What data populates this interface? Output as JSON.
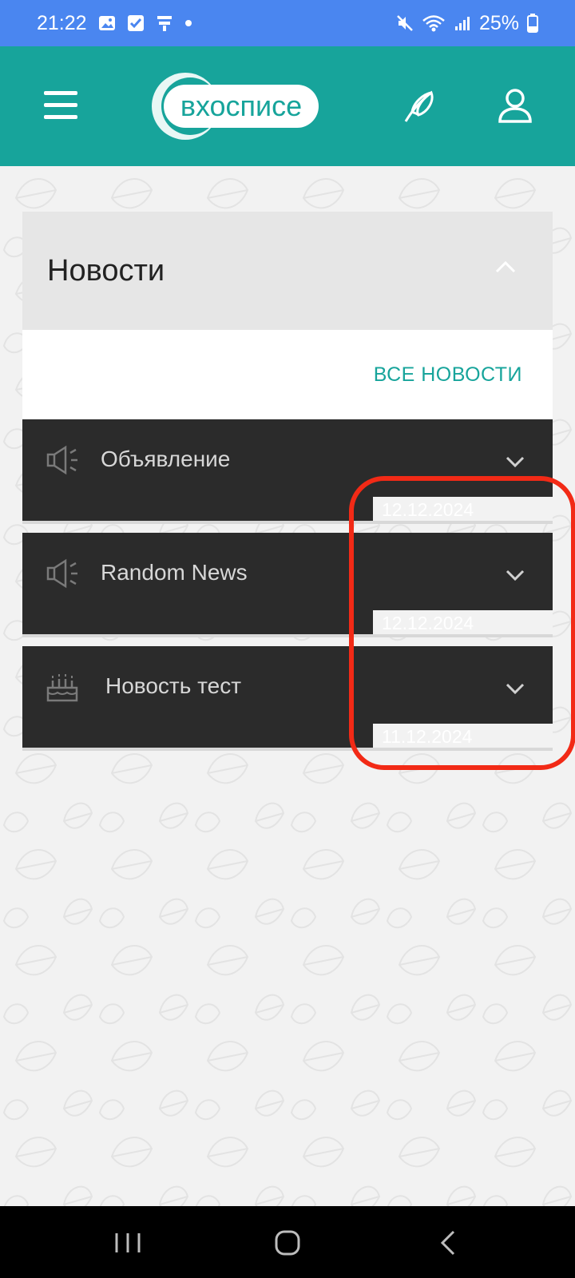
{
  "status_bar": {
    "time": "21:22",
    "battery": "25%",
    "icons_left": [
      "gallery-icon",
      "check-icon",
      "signal-app-icon",
      "dot-icon"
    ],
    "icons_right": [
      "mute-icon",
      "wifi-icon",
      "cell-signal-icon",
      "battery-icon"
    ]
  },
  "app_bar": {
    "logo_text": "вхосписе",
    "colors": {
      "primary": "#17a49b",
      "status": "#4a86f0"
    }
  },
  "section": {
    "title": "Новости",
    "all_news_label": "ВСЕ НОВОСТИ"
  },
  "news": [
    {
      "title": "Объявление",
      "date": "12.12.2024",
      "icon": "megaphone-icon"
    },
    {
      "title": "Random News",
      "date": "12.12.2024",
      "icon": "megaphone-icon"
    },
    {
      "title": "Новость тест",
      "date": "11.12.2024",
      "icon": "cake-icon"
    }
  ],
  "annotation_color": "#f22a16"
}
